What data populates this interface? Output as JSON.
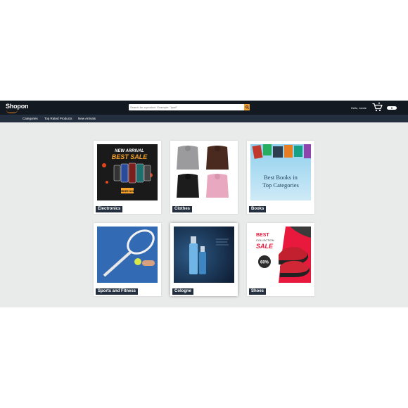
{
  "header": {
    "logo_text": "Shopon",
    "search_placeholder": "Search for a product. Example: \"Ipad\"",
    "greeting": "Hello, Jamie",
    "cart_count": "0",
    "account_label": "0"
  },
  "nav": {
    "items": [
      "Categories",
      "Top Rated Products",
      "New Arrivals"
    ]
  },
  "categories": [
    {
      "label": "Electronics",
      "art": {
        "line1": "NEW ARRIVAL",
        "line2": "BEST SALE",
        "button": "ORDER NOW"
      }
    },
    {
      "label": "Clothes"
    },
    {
      "label": "Books",
      "art": {
        "line1": "Best Books in",
        "line2": "Top Categories"
      }
    },
    {
      "label": "Sports and Fitness"
    },
    {
      "label": "Cologne"
    },
    {
      "label": "Shoes",
      "art": {
        "line1": "BEST",
        "line2": "COLLECTION",
        "line3": "SALE",
        "badge": "60%"
      }
    }
  ],
  "colors": {
    "navbar": "#131921",
    "subbar": "#232f3e",
    "accent": "#f4a02a",
    "page_bg": "#e9eaea"
  }
}
